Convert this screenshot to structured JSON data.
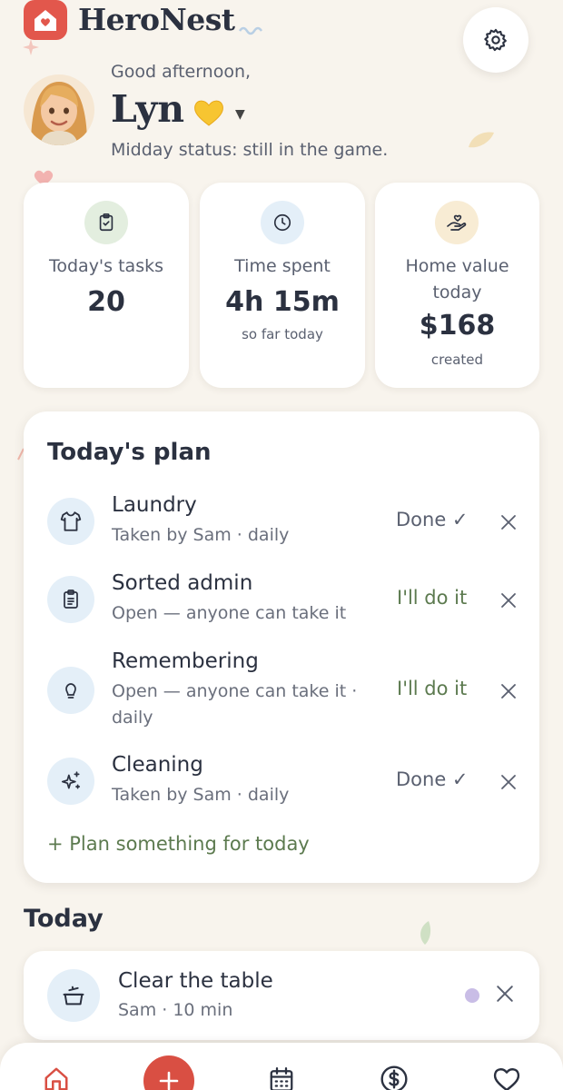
{
  "app": {
    "brand": "HeroNest"
  },
  "colors": {
    "accent": "#e2574c",
    "green": "#5c7a4f",
    "icon_bg": "#e4eff8",
    "background": "#f8f4ed"
  },
  "user": {
    "greeting": "Good afternoon,",
    "name": "Lyn",
    "emoji": "yellow-heart",
    "status": "Midday status: still in the game."
  },
  "stats": [
    {
      "icon": "clipboard-check-icon",
      "label": "Today's tasks",
      "value": "20",
      "sub": ""
    },
    {
      "icon": "clock-icon",
      "label": "Time spent",
      "value": "4h 15m",
      "sub": "so far today"
    },
    {
      "icon": "hand-heart-icon",
      "label": "Home value today",
      "value": "$168",
      "sub": "created"
    }
  ],
  "plan": {
    "title": "Today's plan",
    "items": [
      {
        "icon": "shirt-icon",
        "title": "Laundry",
        "meta": "Taken by Sam · daily",
        "action": "Done ✓",
        "action_type": "done"
      },
      {
        "icon": "clipboard-list-icon",
        "title": "Sorted admin",
        "meta": "Open — anyone can take it",
        "action": "I'll do it",
        "action_type": "take"
      },
      {
        "icon": "lightbulb-icon",
        "title": "Remembering",
        "meta": "Open — anyone can take it · daily",
        "action": "I'll do it",
        "action_type": "take"
      },
      {
        "icon": "sparkles-icon",
        "title": "Cleaning",
        "meta": "Taken by Sam · daily",
        "action": "Done ✓",
        "action_type": "done"
      }
    ],
    "add_label": "+ Plan something for today"
  },
  "today": {
    "heading": "Today",
    "items": [
      {
        "icon": "cooking-pot-icon",
        "title": "Clear the table",
        "meta": "Sam · 10 min"
      }
    ]
  },
  "nav": {
    "items": [
      "home-icon",
      "add-icon",
      "calendar-icon",
      "dollar-icon",
      "heart-icon"
    ]
  }
}
